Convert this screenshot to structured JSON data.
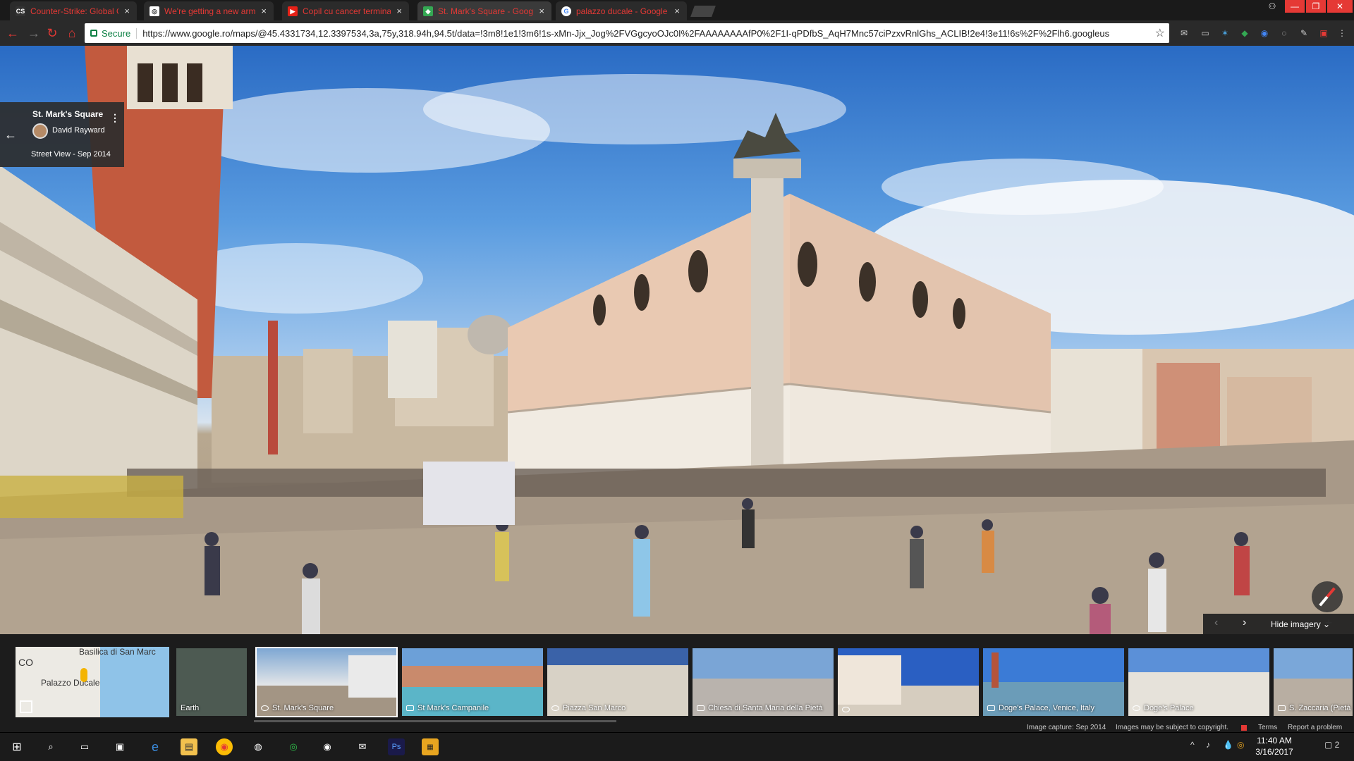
{
  "browser": {
    "tabs": [
      {
        "title": "Counter-Strike: Global O",
        "icon": "cs-favicon",
        "active": false
      },
      {
        "title": "We're getting a new arm",
        "icon": "reddit-favicon",
        "active": false
      },
      {
        "title": "Copil cu cancer terminal",
        "icon": "youtube-favicon",
        "active": false
      },
      {
        "title": "St. Mark's Square - Goog",
        "icon": "maps-favicon",
        "active": true
      },
      {
        "title": "palazzo ducale - Google",
        "icon": "google-favicon",
        "active": false
      }
    ],
    "close_glyph": "×",
    "secure_label": "Secure",
    "url": "https://www.google.ro/maps/@45.4331734,12.3397534,3a,75y,318.94h,94.5t/data=!3m8!1e1!3m6!1s-xMn-Jjx_Jog%2FVGgcyoOJc0I%2FAAAAAAAAfP0%2F1I-qPDfbS_AqH7Mnc57ciPzxvRnlGhs_ACLIB!2e4!3e11!6s%2F%2Flh6.googleus"
  },
  "infocard": {
    "title": "St. Mark's Square",
    "author": "David Rayward",
    "subtitle": "Street View - Sep 2014"
  },
  "viewer": {
    "hide_imagery_label": "Hide imagery",
    "zoom_in": "+",
    "zoom_out": "−"
  },
  "minimap": {
    "labels": [
      "Basilica di San Marc",
      "Palazzo Ducale",
      "CO"
    ]
  },
  "thumbnails": [
    {
      "caption": "Earth",
      "kind": "earth"
    },
    {
      "caption": "St. Mark's Square",
      "kind": "streetview",
      "selected": true
    },
    {
      "caption": "St Mark's Campanile",
      "kind": "photo"
    },
    {
      "caption": "Piazza San Marco",
      "kind": "streetview"
    },
    {
      "caption": "Chiesa di Santa Maria della Pietà",
      "kind": "photo"
    },
    {
      "caption": "",
      "kind": "streetview"
    },
    {
      "caption": "Doge's Palace, Venice, Italy",
      "kind": "photo"
    },
    {
      "caption": "Doge's Palace",
      "kind": "streetview"
    },
    {
      "caption": "S. Zaccaria (Pietà",
      "kind": "photo"
    }
  ],
  "footer": {
    "image_capture": "Image capture: Sep 2014",
    "copyright": "Images may be subject to copyright.",
    "terms": "Terms",
    "report": "Report a problem"
  },
  "taskbar": {
    "time": "11:40 AM",
    "date": "3/16/2017",
    "notification_count": "2"
  },
  "colors": {
    "tab_text": "#e53935",
    "secure_green": "#0b8043",
    "card_bg": "#2d2d2d"
  }
}
